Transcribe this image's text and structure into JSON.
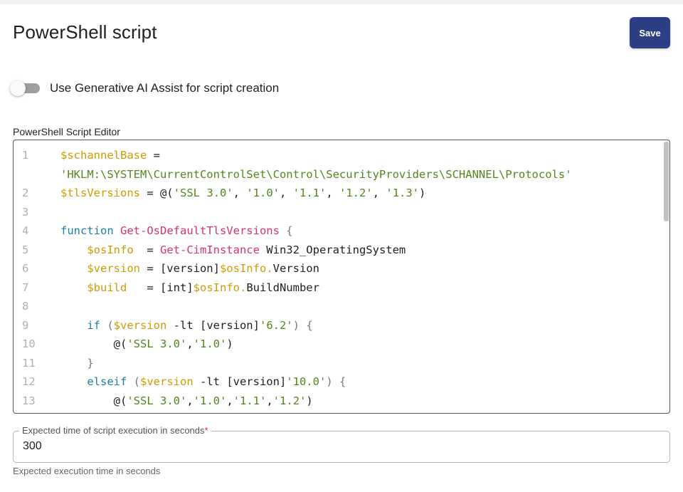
{
  "header": {
    "title": "PowerShell script",
    "save_label": "Save"
  },
  "ai_assist": {
    "label": "Use Generative AI Assist for script creation",
    "enabled": false
  },
  "editor": {
    "label": "PowerShell Script Editor",
    "lines": [
      {
        "n": "1",
        "tokens": [
          {
            "t": "$schannelBase",
            "c": "var"
          },
          {
            "t": " = ",
            "c": "pl"
          }
        ]
      },
      {
        "n": "",
        "tokens": [
          {
            "t": "'HKLM:\\SYSTEM\\CurrentControlSet\\Control\\SecurityProviders\\SCHANNEL\\Protocols'",
            "c": "str"
          }
        ]
      },
      {
        "n": "2",
        "tokens": [
          {
            "t": "$tlsVersions",
            "c": "var"
          },
          {
            "t": " = @(",
            "c": "pl"
          },
          {
            "t": "'SSL 3.0'",
            "c": "str"
          },
          {
            "t": ", ",
            "c": "pl"
          },
          {
            "t": "'1.0'",
            "c": "str"
          },
          {
            "t": ", ",
            "c": "pl"
          },
          {
            "t": "'1.1'",
            "c": "str"
          },
          {
            "t": ", ",
            "c": "pl"
          },
          {
            "t": "'1.2'",
            "c": "str"
          },
          {
            "t": ", ",
            "c": "pl"
          },
          {
            "t": "'1.3'",
            "c": "str"
          },
          {
            "t": ")",
            "c": "pl"
          }
        ]
      },
      {
        "n": "3",
        "tokens": []
      },
      {
        "n": "4",
        "tokens": [
          {
            "t": "function ",
            "c": "kw"
          },
          {
            "t": "Get-OsDefaultTlsVersions",
            "c": "fn"
          },
          {
            "t": " {",
            "c": "op"
          }
        ]
      },
      {
        "n": "5",
        "tokens": [
          {
            "t": "    ",
            "c": "pl"
          },
          {
            "t": "$osInfo",
            "c": "var"
          },
          {
            "t": "  = ",
            "c": "pl"
          },
          {
            "t": "Get-CimInstance",
            "c": "fn"
          },
          {
            "t": " Win32_OperatingSystem",
            "c": "pl"
          }
        ]
      },
      {
        "n": "6",
        "tokens": [
          {
            "t": "    ",
            "c": "pl"
          },
          {
            "t": "$version",
            "c": "var"
          },
          {
            "t": " = [version]",
            "c": "pl"
          },
          {
            "t": "$osInfo.",
            "c": "var"
          },
          {
            "t": "Version",
            "c": "pl"
          }
        ]
      },
      {
        "n": "7",
        "tokens": [
          {
            "t": "    ",
            "c": "pl"
          },
          {
            "t": "$build",
            "c": "var"
          },
          {
            "t": "   = [int]",
            "c": "pl"
          },
          {
            "t": "$osInfo.",
            "c": "var"
          },
          {
            "t": "BuildNumber",
            "c": "pl"
          }
        ]
      },
      {
        "n": "8",
        "tokens": []
      },
      {
        "n": "9",
        "tokens": [
          {
            "t": "    ",
            "c": "pl"
          },
          {
            "t": "if",
            "c": "kw"
          },
          {
            "t": " (",
            "c": "op"
          },
          {
            "t": "$version",
            "c": "var"
          },
          {
            "t": " -lt [version]",
            "c": "pl"
          },
          {
            "t": "'6.2'",
            "c": "str"
          },
          {
            "t": ") {",
            "c": "op"
          }
        ]
      },
      {
        "n": "10",
        "tokens": [
          {
            "t": "        @(",
            "c": "pl"
          },
          {
            "t": "'SSL 3.0'",
            "c": "str"
          },
          {
            "t": ",",
            "c": "pl"
          },
          {
            "t": "'1.0'",
            "c": "str"
          },
          {
            "t": ")",
            "c": "pl"
          }
        ]
      },
      {
        "n": "11",
        "tokens": [
          {
            "t": "    }",
            "c": "op"
          }
        ]
      },
      {
        "n": "12",
        "tokens": [
          {
            "t": "    ",
            "c": "pl"
          },
          {
            "t": "elseif",
            "c": "kw"
          },
          {
            "t": " (",
            "c": "op"
          },
          {
            "t": "$version",
            "c": "var"
          },
          {
            "t": " -lt [version]",
            "c": "pl"
          },
          {
            "t": "'10.0'",
            "c": "str"
          },
          {
            "t": ") {",
            "c": "op"
          }
        ]
      },
      {
        "n": "13",
        "tokens": [
          {
            "t": "        @(",
            "c": "pl"
          },
          {
            "t": "'SSL 3.0'",
            "c": "str"
          },
          {
            "t": ",",
            "c": "pl"
          },
          {
            "t": "'1.0'",
            "c": "str"
          },
          {
            "t": ",",
            "c": "pl"
          },
          {
            "t": "'1.1'",
            "c": "str"
          },
          {
            "t": ",",
            "c": "pl"
          },
          {
            "t": "'1.2'",
            "c": "str"
          },
          {
            "t": ")",
            "c": "pl"
          }
        ]
      }
    ]
  },
  "execution_time": {
    "label": "Expected time of script execution in seconds",
    "required_mark": "*",
    "value": "300",
    "helper": "Expected execution time in seconds"
  },
  "colors": {
    "save_button": "#2d3f84",
    "variable": "#d19a00",
    "string": "#53861a",
    "function": "#d6336c",
    "keyword": "#1a7fa8"
  }
}
